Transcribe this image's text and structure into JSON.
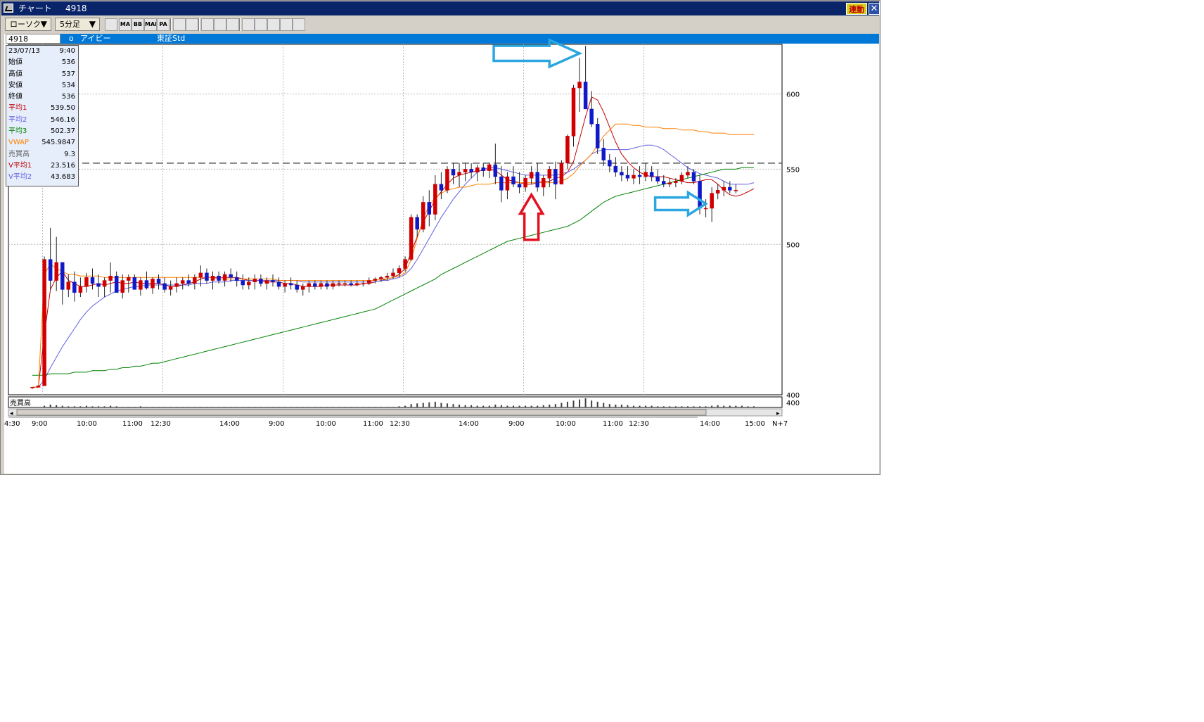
{
  "window": {
    "title": "チャート",
    "code": "4918",
    "link_label": "連動",
    "close_label": "✕"
  },
  "toolbar": {
    "chart_type": "ローソク",
    "interval": "5分足",
    "dropdown_arrow": "▼",
    "tool_icons": [
      "candle-settings-icon",
      "ma-icon",
      "bb-icon",
      "mae-icon",
      "pa-icon",
      "trend-icon",
      "param-icon",
      "zoom-icon",
      "table-icon",
      "draw-line-icon",
      "cursor-icon",
      "erase-line-icon",
      "trash-icon",
      "settings-icon",
      "clear-icon"
    ],
    "tool_labels": [
      "",
      "MA",
      "BB",
      "MAE",
      "PA",
      "",
      "",
      "",
      "",
      "",
      "",
      "",
      "",
      "",
      ""
    ]
  },
  "info_bar": {
    "code": "4918",
    "marker": "o",
    "name": "アイビー",
    "market": "東証Std"
  },
  "legend": {
    "date": "23/07/13",
    "time": "9:40",
    "rows": [
      {
        "label": "始値",
        "value": "536",
        "color": "#000000"
      },
      {
        "label": "高値",
        "value": "537",
        "color": "#000000"
      },
      {
        "label": "安値",
        "value": "534",
        "color": "#000000"
      },
      {
        "label": "終値",
        "value": "536",
        "color": "#000000"
      },
      {
        "label": "平均1",
        "value": "539.50",
        "color": "#c00000"
      },
      {
        "label": "平均2",
        "value": "546.16",
        "color": "#6060e0"
      },
      {
        "label": "平均3",
        "value": "502.37",
        "color": "#008000"
      },
      {
        "label": "VWAP",
        "value": "545.9847",
        "color": "#ff8000"
      },
      {
        "label": "売買高",
        "value": "9.3",
        "color": "#606060"
      },
      {
        "label": "V平均1",
        "value": "23.516",
        "color": "#c00000"
      },
      {
        "label": "V平均2",
        "value": "43.683",
        "color": "#6060e0"
      }
    ]
  },
  "chart_data": {
    "type": "candlestick",
    "ylim": [
      400,
      633
    ],
    "y_ticks": [
      "600",
      "550",
      "500",
      "400"
    ],
    "x_tick_labels": [
      "4:30",
      "9:00",
      "10:00",
      "11:00",
      "12:30",
      "14:00",
      "9:00",
      "10:00",
      "11:00",
      "12:30",
      "14:00",
      "9:00",
      "10:00",
      "11:00",
      "12:30",
      "14:00",
      "15:00",
      "N+7"
    ],
    "volume_label": "売買高",
    "reference_line": 554,
    "candles_ohlc": [
      [
        405,
        405,
        404,
        405
      ],
      [
        405,
        406,
        405,
        406
      ],
      [
        406,
        492,
        406,
        490
      ],
      [
        490,
        511,
        470,
        476
      ],
      [
        476,
        505,
        469,
        488
      ],
      [
        488,
        488,
        460,
        470
      ],
      [
        470,
        480,
        465,
        475
      ],
      [
        475,
        482,
        462,
        468
      ],
      [
        468,
        478,
        465,
        472
      ],
      [
        472,
        481,
        468,
        478
      ],
      [
        478,
        484,
        470,
        474
      ],
      [
        474,
        480,
        465,
        472
      ],
      [
        472,
        478,
        465,
        476
      ],
      [
        476,
        488,
        468,
        479
      ],
      [
        479,
        482,
        470,
        468
      ],
      [
        468,
        480,
        464,
        476
      ],
      [
        476,
        480,
        468,
        478
      ],
      [
        478,
        480,
        472,
        470
      ],
      [
        470,
        478,
        466,
        476
      ],
      [
        476,
        482,
        470,
        471
      ],
      [
        471,
        478,
        467,
        477
      ],
      [
        477,
        480,
        470,
        474
      ],
      [
        474,
        478,
        468,
        470
      ],
      [
        470,
        476,
        466,
        472
      ],
      [
        472,
        478,
        468,
        474
      ],
      [
        474,
        478,
        470,
        476
      ],
      [
        476,
        480,
        472,
        474
      ],
      [
        474,
        480,
        470,
        478
      ],
      [
        478,
        486,
        472,
        481
      ],
      [
        481,
        484,
        474,
        476
      ],
      [
        476,
        482,
        470,
        479
      ],
      [
        479,
        482,
        474,
        476
      ],
      [
        476,
        482,
        472,
        480
      ],
      [
        480,
        484,
        475,
        478
      ],
      [
        478,
        482,
        472,
        476
      ],
      [
        476,
        480,
        470,
        473
      ],
      [
        473,
        478,
        470,
        475
      ],
      [
        475,
        480,
        470,
        477
      ],
      [
        477,
        480,
        472,
        474
      ],
      [
        474,
        478,
        470,
        476
      ],
      [
        476,
        480,
        472,
        475
      ],
      [
        475,
        478,
        470,
        472
      ],
      [
        472,
        476,
        468,
        474
      ],
      [
        474,
        478,
        470,
        473
      ],
      [
        473,
        476,
        468,
        470
      ],
      [
        470,
        474,
        466,
        472
      ],
      [
        472,
        476,
        468,
        474
      ],
      [
        474,
        476,
        470,
        472
      ],
      [
        472,
        476,
        470,
        474
      ],
      [
        474,
        476,
        470,
        472
      ],
      [
        472,
        476,
        470,
        474
      ],
      [
        474,
        476,
        472,
        474
      ],
      [
        474,
        476,
        472,
        474
      ],
      [
        474,
        476,
        472,
        473
      ],
      [
        473,
        476,
        472,
        474
      ],
      [
        474,
        476,
        472,
        474
      ],
      [
        474,
        478,
        473,
        476
      ],
      [
        476,
        478,
        474,
        477
      ],
      [
        477,
        479,
        475,
        478
      ],
      [
        478,
        481,
        476,
        479
      ],
      [
        479,
        484,
        477,
        481
      ],
      [
        481,
        486,
        478,
        484
      ],
      [
        484,
        492,
        482,
        490
      ],
      [
        490,
        520,
        489,
        518
      ],
      [
        518,
        520,
        505,
        510
      ],
      [
        510,
        532,
        508,
        528
      ],
      [
        528,
        536,
        512,
        520
      ],
      [
        520,
        546,
        516,
        540
      ],
      [
        540,
        548,
        530,
        536
      ],
      [
        536,
        552,
        534,
        550
      ],
      [
        550,
        554,
        540,
        546
      ],
      [
        546,
        554,
        538,
        548
      ],
      [
        548,
        554,
        542,
        550
      ],
      [
        550,
        554,
        544,
        548
      ],
      [
        548,
        553,
        542,
        551
      ],
      [
        551,
        554,
        545,
        549
      ],
      [
        549,
        554,
        544,
        553
      ],
      [
        553,
        567,
        540,
        545
      ],
      [
        545,
        552,
        528,
        536
      ],
      [
        536,
        548,
        530,
        545
      ],
      [
        545,
        552,
        538,
        540
      ],
      [
        540,
        548,
        534,
        538
      ],
      [
        538,
        546,
        535,
        544
      ],
      [
        544,
        552,
        540,
        548
      ],
      [
        548,
        554,
        535,
        538
      ],
      [
        538,
        546,
        532,
        544
      ],
      [
        544,
        552,
        538,
        550
      ],
      [
        550,
        555,
        530,
        540
      ],
      [
        540,
        556,
        540,
        554
      ],
      [
        554,
        573,
        550,
        572
      ],
      [
        572,
        606,
        565,
        604
      ],
      [
        604,
        624,
        588,
        608
      ],
      [
        608,
        632,
        598,
        590
      ],
      [
        590,
        602,
        578,
        580
      ],
      [
        580,
        584,
        560,
        564
      ],
      [
        564,
        570,
        552,
        556
      ],
      [
        556,
        560,
        548,
        552
      ],
      [
        552,
        558,
        545,
        548
      ],
      [
        548,
        552,
        542,
        546
      ],
      [
        546,
        552,
        542,
        544
      ],
      [
        544,
        550,
        540,
        546
      ],
      [
        546,
        552,
        540,
        545
      ],
      [
        545,
        554,
        542,
        548
      ],
      [
        548,
        552,
        542,
        545
      ],
      [
        545,
        550,
        540,
        542
      ],
      [
        542,
        546,
        538,
        540
      ],
      [
        540,
        544,
        538,
        541
      ],
      [
        541,
        544,
        538,
        542
      ],
      [
        542,
        548,
        540,
        546
      ],
      [
        546,
        552,
        544,
        548
      ],
      [
        548,
        550,
        540,
        542
      ],
      [
        542,
        546,
        520,
        524
      ],
      [
        524,
        530,
        518,
        524
      ],
      [
        524,
        538,
        515,
        534
      ],
      [
        534,
        540,
        530,
        536
      ],
      [
        536,
        542,
        532,
        538
      ],
      [
        538,
        542,
        534,
        536
      ],
      [
        536,
        540,
        534,
        536
      ]
    ],
    "series": [
      {
        "name": "平均1",
        "color": "#c00000",
        "values": [
          405,
          405,
          440,
          470,
          478,
          482,
          476,
          474,
          472,
          472,
          473,
          474,
          473,
          474,
          475,
          474,
          474,
          475,
          474,
          474,
          474,
          474,
          473,
          472,
          472,
          473,
          474,
          475,
          477,
          478,
          478,
          478,
          478,
          478,
          478,
          477,
          476,
          476,
          476,
          475,
          475,
          475,
          474,
          474,
          473,
          472,
          472,
          472,
          472,
          473,
          473,
          473,
          473,
          473,
          473,
          474,
          474,
          475,
          476,
          477,
          478,
          480,
          484,
          495,
          505,
          515,
          522,
          530,
          535,
          540,
          544,
          546,
          547,
          548,
          549,
          549,
          550,
          549,
          546,
          543,
          542,
          541,
          540,
          540,
          541,
          542,
          542,
          544,
          545,
          548,
          555,
          570,
          585,
          598,
          596,
          588,
          578,
          568,
          560,
          555,
          551,
          548,
          546,
          545,
          545,
          545,
          544,
          543,
          542,
          541,
          541,
          542,
          543,
          543,
          540,
          536,
          533,
          532,
          533,
          535,
          537
        ]
      },
      {
        "name": "平均2",
        "color": "#6060e0",
        "values": [
          405,
          405,
          410,
          418,
          425,
          432,
          438,
          444,
          450,
          455,
          459,
          462,
          465,
          467,
          469,
          470,
          471,
          472,
          472,
          473,
          473,
          473,
          473,
          473,
          473,
          473,
          473,
          474,
          474,
          474,
          475,
          475,
          475,
          476,
          476,
          476,
          476,
          476,
          476,
          476,
          476,
          476,
          476,
          476,
          476,
          475,
          475,
          475,
          475,
          475,
          475,
          475,
          475,
          475,
          475,
          475,
          475,
          475,
          476,
          476,
          477,
          478,
          480,
          484,
          490,
          497,
          504,
          511,
          518,
          524,
          530,
          535,
          540,
          544,
          548,
          550,
          551,
          551,
          550,
          549,
          548,
          547,
          546,
          546,
          546,
          546,
          546,
          546,
          547,
          548,
          550,
          553,
          556,
          560,
          562,
          563,
          563,
          563,
          563,
          563,
          564,
          565,
          566,
          566,
          565,
          563,
          560,
          557,
          554,
          551,
          549,
          547,
          546,
          545,
          544,
          542,
          540,
          540,
          540,
          540,
          541
        ]
      },
      {
        "name": "平均3",
        "color": "#008000",
        "values": [
          413,
          413,
          413,
          414,
          414,
          414,
          414,
          415,
          415,
          415,
          416,
          416,
          416,
          417,
          417,
          418,
          418,
          419,
          419,
          420,
          421,
          421,
          422,
          423,
          424,
          425,
          426,
          427,
          428,
          429,
          430,
          431,
          432,
          433,
          434,
          435,
          436,
          437,
          438,
          439,
          440,
          441,
          442,
          443,
          444,
          445,
          446,
          447,
          448,
          449,
          450,
          451,
          452,
          453,
          454,
          455,
          456,
          457,
          459,
          461,
          463,
          465,
          467,
          469,
          471,
          473,
          475,
          477,
          480,
          482,
          484,
          486,
          488,
          490,
          492,
          494,
          496,
          498,
          500,
          502,
          503,
          504,
          505,
          506,
          507,
          508,
          509,
          510,
          511,
          512,
          514,
          516,
          519,
          522,
          525,
          528,
          530,
          532,
          533,
          534,
          535,
          536,
          537,
          538,
          539,
          540,
          541,
          542,
          543,
          544,
          545,
          546,
          547,
          548,
          549,
          550,
          550,
          550,
          551,
          551,
          551
        ]
      },
      {
        "name": "VWAP",
        "color": "#ff8000",
        "values": [
          405,
          405,
          480,
          487,
          484,
          482,
          480,
          480,
          479,
          479,
          479,
          479,
          478,
          478,
          478,
          478,
          478,
          478,
          478,
          478,
          478,
          478,
          478,
          478,
          478,
          478,
          478,
          478,
          478,
          478,
          478,
          477,
          477,
          477,
          477,
          477,
          477,
          477,
          477,
          477,
          477,
          476,
          476,
          476,
          476,
          476,
          476,
          476,
          476,
          476,
          476,
          476,
          476,
          476,
          476,
          476,
          476,
          476,
          477,
          477,
          478,
          479,
          481,
          490,
          504,
          517,
          526,
          531,
          534,
          536,
          537,
          538,
          538,
          539,
          540,
          540,
          540,
          541,
          541,
          541,
          541,
          541,
          541,
          541,
          541,
          541,
          541,
          541,
          542,
          544,
          547,
          552,
          556,
          560,
          566,
          572,
          576,
          580,
          580,
          580,
          579,
          579,
          578,
          578,
          578,
          577,
          577,
          577,
          576,
          576,
          576,
          575,
          575,
          574,
          574,
          574,
          573,
          573,
          573,
          573,
          573
        ]
      }
    ],
    "volume": [
      0,
      0,
      3,
      5,
      4,
      3,
      2,
      2,
      2,
      3,
      2,
      2,
      2,
      3,
      2,
      1,
      1,
      1,
      2,
      1,
      1,
      1,
      1,
      1,
      1,
      1,
      1,
      1,
      1,
      1,
      1,
      1,
      1,
      1,
      1,
      1,
      1,
      1,
      1,
      1,
      1,
      1,
      1,
      1,
      1,
      1,
      1,
      1,
      1,
      1,
      1,
      1,
      1,
      1,
      1,
      1,
      1,
      1,
      1,
      1,
      1,
      2,
      3,
      6,
      7,
      8,
      9,
      10,
      8,
      7,
      6,
      5,
      4,
      4,
      3,
      3,
      3,
      5,
      4,
      3,
      3,
      3,
      3,
      3,
      3,
      4,
      5,
      6,
      8,
      10,
      12,
      14,
      16,
      12,
      10,
      8,
      6,
      5,
      5,
      4,
      3,
      3,
      3,
      3,
      2,
      2,
      2,
      2,
      2,
      2,
      2,
      2,
      2,
      3,
      4,
      3,
      3,
      3,
      3,
      2,
      2
    ],
    "annotations": [
      {
        "kind": "arrow-right",
        "color": "#2aa6e0",
        "candle": 91,
        "price": 627
      },
      {
        "kind": "arrow-up",
        "color": "#e3111f",
        "candle": 83,
        "price": 533
      },
      {
        "kind": "arrow-right",
        "color": "#2aa6e0",
        "candle": 112,
        "price": 527
      }
    ]
  }
}
